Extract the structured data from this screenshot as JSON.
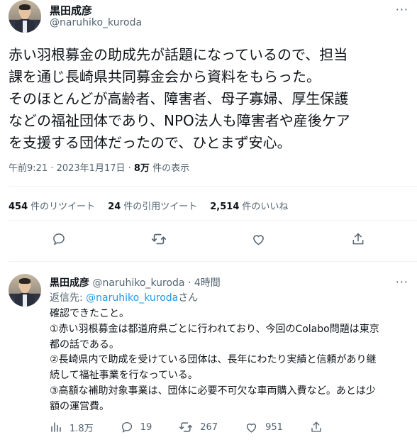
{
  "tweet": {
    "author_name": "黒田成彦",
    "author_handle": "@naruhiko_kuroda",
    "text": "赤い羽根募金の助成先が話題になっているので、担当\n課を通じ長崎県共同募金会から資料をもらった。\nそのほとんどが高齢者、障害者、母子寡婦、厚生保護\nなどの福祉団体であり、NPO法人も障害者や産後ケア\nを支援する団体だったので、ひとまず安心。",
    "timestamp": "午前9:21 · 2023年1月17日 · ",
    "views_count": "8万",
    "views_label": " 件の表示",
    "retweets_count": "454",
    "retweets_label": "件のリツイート",
    "quotes_count": "24",
    "quotes_label": "件の引用ツイート",
    "likes_count": "2,514",
    "likes_label": "件のいいね",
    "more_icon": "more-icon"
  },
  "reply": {
    "author_name": "黒田成彦",
    "author_meta": " @naruhiko_kuroda · 4時間",
    "replying_prefix": "返信先: ",
    "replying_mention": "@naruhiko_kuroda",
    "replying_suffix": "さん",
    "text": "確認できたこと。\n①赤い羽根募金は都道府県ごとに行われており、今回のColabo問題は東京\n都の話である。\n②長崎県内で助成を受けている団体は、長年にわたり実績と信頼があり継\n続して福祉事業を行なっている。\n③高額な補助対象事業は、団体に必要不可欠な車両購入費など。あとは少\n額の運営費。",
    "views": "1.8万",
    "replies": "19",
    "retweets": "267",
    "likes": "951"
  },
  "colors": {
    "accent": "#1d9bf0",
    "muted": "#536471",
    "text": "#0f1419"
  }
}
